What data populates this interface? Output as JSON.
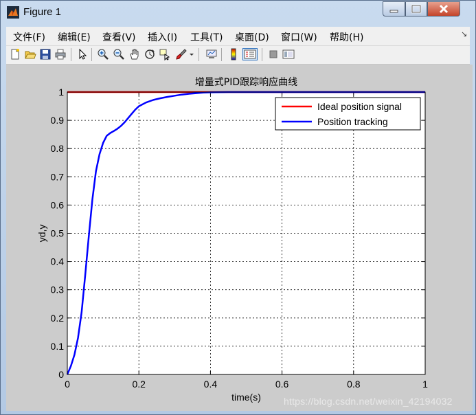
{
  "window": {
    "title": "Figure 1",
    "menus": [
      "文件(F)",
      "编辑(E)",
      "查看(V)",
      "插入(I)",
      "工具(T)",
      "桌面(D)",
      "窗口(W)",
      "帮助(H)"
    ],
    "toolbar_icons": [
      "new-file-icon",
      "open-folder-icon",
      "save-icon",
      "print-icon",
      "pointer-icon",
      "zoom-in-icon",
      "zoom-out-icon",
      "pan-hand-icon",
      "rotate-3d-icon",
      "data-cursor-icon",
      "brush-icon",
      "brush-dropdown-icon",
      "link-plot-icon",
      "colorbar-icon",
      "legend-icon",
      "hide-plot-tools-icon",
      "show-plot-tools-icon"
    ]
  },
  "chart_data": {
    "type": "line",
    "title": "增量式PID跟踪响应曲线",
    "xlabel": "time(s)",
    "ylabel": "yd,y",
    "xlim": [
      0,
      1
    ],
    "ylim": [
      0,
      1
    ],
    "xticks": [
      "0",
      "0.2",
      "0.4",
      "0.6",
      "0.8",
      "1"
    ],
    "yticks": [
      "0",
      "0.1",
      "0.2",
      "0.3",
      "0.4",
      "0.5",
      "0.6",
      "0.7",
      "0.8",
      "0.9",
      "1"
    ],
    "grid": true,
    "legend_position": "top-right",
    "series": [
      {
        "name": "Ideal position signal",
        "color": "#ff0000",
        "x": [
          0,
          1
        ],
        "y": [
          1,
          1
        ]
      },
      {
        "name": "Position tracking",
        "color": "#0000ff",
        "x": [
          0,
          0.01,
          0.02,
          0.03,
          0.04,
          0.05,
          0.06,
          0.07,
          0.08,
          0.09,
          0.1,
          0.11,
          0.12,
          0.13,
          0.14,
          0.15,
          0.16,
          0.17,
          0.18,
          0.19,
          0.2,
          0.22,
          0.24,
          0.26,
          0.28,
          0.3,
          0.32,
          0.34,
          0.36,
          0.38,
          0.4,
          0.45,
          0.5,
          0.6,
          0.7,
          0.8,
          0.9,
          1.0
        ],
        "y": [
          0,
          0.03,
          0.07,
          0.13,
          0.22,
          0.35,
          0.49,
          0.62,
          0.72,
          0.78,
          0.82,
          0.845,
          0.855,
          0.862,
          0.87,
          0.88,
          0.893,
          0.908,
          0.923,
          0.938,
          0.95,
          0.963,
          0.972,
          0.978,
          0.983,
          0.987,
          0.991,
          0.994,
          0.996,
          0.998,
          0.999,
          1.0,
          1.0,
          1.0,
          1.0,
          1.0,
          1.0,
          1.0
        ]
      }
    ]
  },
  "watermark": "https://blog.csdn.net/weixin_42194032"
}
